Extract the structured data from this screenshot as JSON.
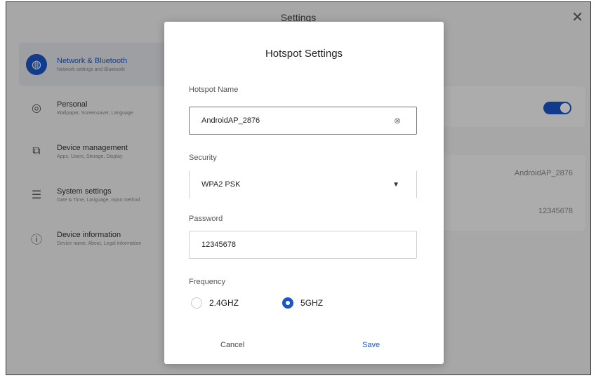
{
  "app": {
    "title": "Settings",
    "close_icon": "close-icon",
    "sidebar": [
      {
        "label": "Network & Bluetooth",
        "sub": "Network settings and Bluetooth",
        "icon": "globe-icon",
        "glyph": "◍",
        "active": true
      },
      {
        "label": "Personal",
        "sub": "Wallpaper, Screensaver, Language",
        "icon": "palette-icon",
        "glyph": "◎",
        "active": false
      },
      {
        "label": "Device management",
        "sub": "Apps, Users, Storage, Display",
        "icon": "device-icon",
        "glyph": "⧉",
        "active": false
      },
      {
        "label": "System settings",
        "sub": "Date & Time, Language, Input method",
        "icon": "sliders-icon",
        "glyph": "☰",
        "active": false
      },
      {
        "label": "Device information",
        "sub": "Device name, About, Legal information",
        "icon": "info-icon",
        "glyph": "ⓘ",
        "active": false
      }
    ],
    "hotspot_name_value": "AndroidAP_2876",
    "password_value": "12345678",
    "accent": "#1a56c8"
  },
  "dialog": {
    "title": "Hotspot Settings",
    "name_label": "Hotspot Name",
    "name_value": "AndroidAP_2876",
    "security_label": "Security",
    "security_value": "WPA2 PSK",
    "password_label": "Password",
    "password_value": "12345678",
    "frequency_label": "Frequency",
    "freq_options": [
      {
        "label": "2.4GHZ",
        "selected": false
      },
      {
        "label": "5GHZ",
        "selected": true
      }
    ],
    "cancel_label": "Cancel",
    "save_label": "Save"
  }
}
